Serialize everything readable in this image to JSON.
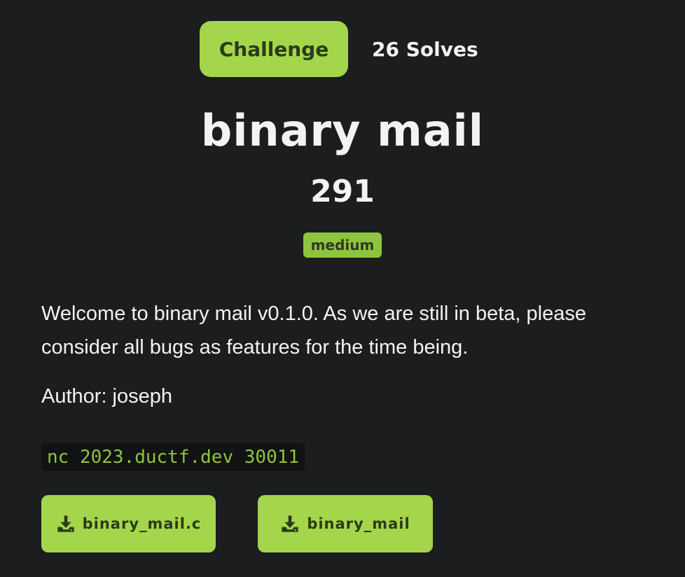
{
  "tabs": {
    "challenge_label": "Challenge",
    "solves_label": "26 Solves"
  },
  "challenge": {
    "name": "binary mail",
    "points": "291",
    "difficulty": "medium",
    "description": "Welcome to binary mail v0.1.0. As we are still in beta, please consider all bugs as features for the time being.",
    "author": "Author: joseph",
    "connection": "nc 2023.ductf.dev 30011"
  },
  "files": [
    {
      "name": "binary_mail.c",
      "icon": "download-icon"
    },
    {
      "name": "binary_mail",
      "icon": "download-icon"
    }
  ],
  "colors": {
    "background": "#1c1d1f",
    "accent": "#a3d64a",
    "badge": "#8fc43e",
    "code_text": "#8fc43e"
  }
}
